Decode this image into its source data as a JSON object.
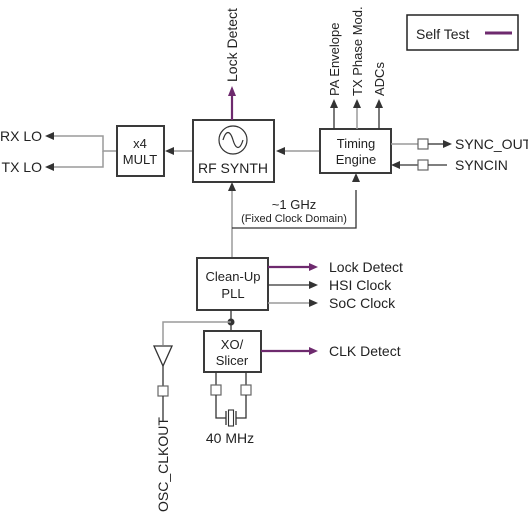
{
  "diagram": {
    "legend": {
      "label": "Self Test",
      "color": "#6e2a6e"
    },
    "blocks": {
      "mult": {
        "line1": "x4",
        "line2": "MULT"
      },
      "rf_synth": {
        "label": "RF SYNTH",
        "icon": "sine-oscillator-icon"
      },
      "timing": {
        "line1": "Timing",
        "line2": "Engine"
      },
      "cleanup": {
        "line1": "Clean-Up",
        "line2": "PLL"
      },
      "xo": {
        "line1": "XO/",
        "line2": "Slicer"
      }
    },
    "signals": {
      "rx_lo": "RX LO",
      "tx_lo": "TX LO",
      "rf_lock_detect": "Lock Detect",
      "pa_envelope": "PA Envelope",
      "tx_phase_mod": "TX Phase Mod.",
      "adcs": "ADCs",
      "sync_out": "SYNC_OUT",
      "syncin": "SYNCIN",
      "clock_freq": "~1 GHz",
      "clock_domain": "(Fixed Clock Domain)",
      "pll_lock_detect": "Lock Detect",
      "hsi_clock": "HSI Clock",
      "soc_clock": "SoC Clock",
      "clk_detect": "CLK Detect",
      "osc_clkout": "OSC_CLKOUT",
      "crystal_freq": "40 MHz"
    }
  }
}
